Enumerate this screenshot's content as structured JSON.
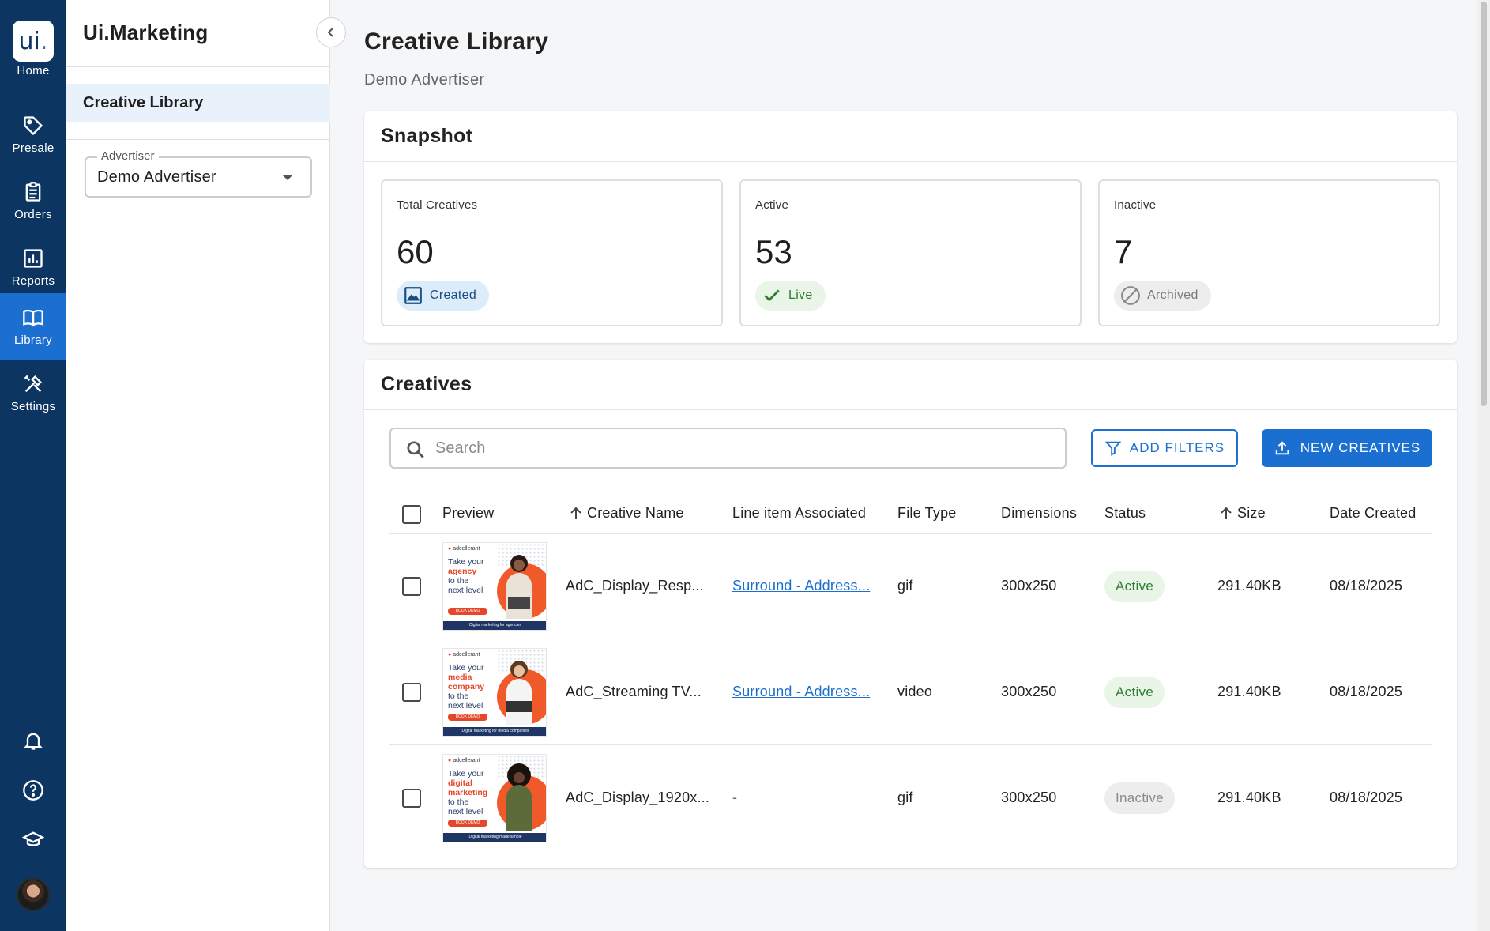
{
  "rail": {
    "logo": "ui",
    "logo_dot": ".",
    "items": [
      {
        "label": "Home",
        "icon": "home-logo"
      },
      {
        "label": "Presale",
        "icon": "tag-icon"
      },
      {
        "label": "Orders",
        "icon": "clipboard-icon"
      },
      {
        "label": "Reports",
        "icon": "bar-chart-icon"
      },
      {
        "label": "Library",
        "icon": "book-icon",
        "active": true
      },
      {
        "label": "Settings",
        "icon": "tools-icon"
      }
    ],
    "bottom_icons": [
      "bell-icon",
      "help-icon",
      "graduation-cap-icon",
      "avatar"
    ]
  },
  "sidebar": {
    "app_title": "Ui.Marketing",
    "nav_item": "Creative Library",
    "advertiser_legend": "Advertiser",
    "advertiser_value": "Demo Advertiser"
  },
  "page": {
    "title": "Creative Library",
    "subtitle": "Demo Advertiser"
  },
  "snapshot": {
    "title": "Snapshot",
    "stats": [
      {
        "label": "Total Creatives",
        "value": "60",
        "chip": "Created"
      },
      {
        "label": "Active",
        "value": "53",
        "chip": "Live"
      },
      {
        "label": "Inactive",
        "value": "7",
        "chip": "Archived"
      }
    ]
  },
  "creatives": {
    "title": "Creatives",
    "search_placeholder": "Search",
    "add_filters": "ADD FILTERS",
    "new_creatives": "NEW CREATIVES",
    "columns": [
      "Preview",
      "Creative Name",
      "Line item Associated",
      "File Type",
      "Dimensions",
      "Status",
      "Size",
      "Date Created"
    ],
    "rows": [
      {
        "name": "AdC_Display_Resp...",
        "line_item": "Surround - Address...",
        "file_type": "gif",
        "dimensions": "300x250",
        "status": "Active",
        "size": "291.40KB",
        "date": "08/18/2025",
        "thumb": {
          "brand": "adcellerant",
          "h1": "Take your",
          "h2": "agency",
          "h3": "to the",
          "h4": "next level",
          "cta": "BOOK DEMO",
          "foot": "Digital marketing for agencies"
        }
      },
      {
        "name": "AdC_Streaming TV...",
        "line_item": "Surround - Address...",
        "file_type": "video",
        "dimensions": "300x250",
        "status": "Active",
        "size": "291.40KB",
        "date": "08/18/2025",
        "thumb": {
          "brand": "adcellerant",
          "h1": "Take your",
          "h2": "media company",
          "h3": "to the",
          "h4": "next level",
          "cta": "BOOK DEMO",
          "foot": "Digital marketing for media companies"
        }
      },
      {
        "name": "AdC_Display_1920x...",
        "line_item": "-",
        "file_type": "gif",
        "dimensions": "300x250",
        "status": "Inactive",
        "size": "291.40KB",
        "date": "08/18/2025",
        "thumb": {
          "brand": "adcellerant",
          "h1": "Take your",
          "h2": "digital marketing",
          "h3": "to the",
          "h4": "next level",
          "cta": "BOOK DEMO",
          "foot": "Digital marketing made simple"
        }
      }
    ]
  },
  "colors": {
    "rail": "#0d3561",
    "accent": "#1b6fd1",
    "active_green": "#2e7d32",
    "brand_orange": "#e4472a"
  }
}
